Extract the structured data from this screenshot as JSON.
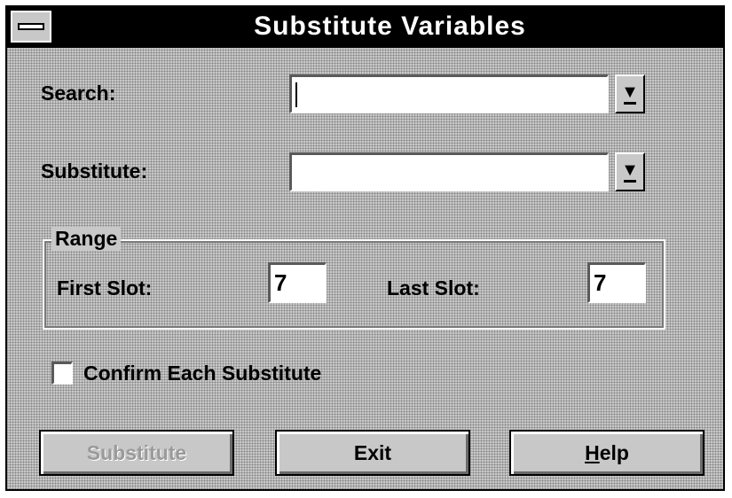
{
  "window": {
    "title": "Substitute Variables",
    "system_menu_icon": "system-menu-icon"
  },
  "search": {
    "label": "Search:",
    "value": "",
    "dropdown_icon": "dropdown-arrow-icon"
  },
  "substitute": {
    "label": "Substitute:",
    "value": "",
    "dropdown_icon": "dropdown-arrow-icon"
  },
  "range": {
    "label": "Range",
    "first_slot_label": "First Slot:",
    "first_slot_value": "7",
    "last_slot_label": "Last Slot:",
    "last_slot_value": "7"
  },
  "confirm": {
    "label": "Confirm Each Substitute",
    "checked": false
  },
  "buttons": {
    "substitute_label": "Substitute",
    "substitute_enabled": false,
    "exit_label": "Exit",
    "help_label_mnemonic": "H",
    "help_label_rest": "elp"
  },
  "colors": {
    "dialog_bg": "#c8c8c8",
    "titlebar_bg": "#000000",
    "title_text": "#ffffff",
    "disabled_text": "#9a9a9a"
  }
}
